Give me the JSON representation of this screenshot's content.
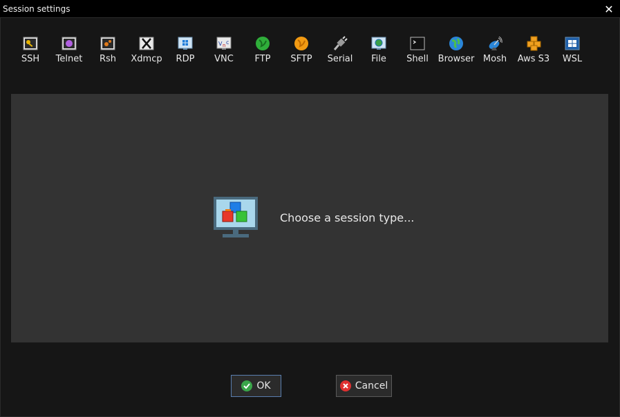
{
  "window": {
    "title": "Session settings",
    "close_glyph": "✕"
  },
  "session_types": [
    {
      "label": "SSH",
      "icon": "ssh-key-icon"
    },
    {
      "label": "Telnet",
      "icon": "telnet-icon"
    },
    {
      "label": "Rsh",
      "icon": "rsh-icon"
    },
    {
      "label": "Xdmcp",
      "icon": "xdmcp-icon"
    },
    {
      "label": "RDP",
      "icon": "rdp-icon"
    },
    {
      "label": "VNC",
      "icon": "vnc-icon"
    },
    {
      "label": "FTP",
      "icon": "ftp-globe-icon"
    },
    {
      "label": "SFTP",
      "icon": "sftp-globe-icon"
    },
    {
      "label": "Serial",
      "icon": "serial-plug-icon"
    },
    {
      "label": "File",
      "icon": "file-icon"
    },
    {
      "label": "Shell",
      "icon": "shell-terminal-icon"
    },
    {
      "label": "Browser",
      "icon": "browser-globe-icon"
    },
    {
      "label": "Mosh",
      "icon": "mosh-satellite-icon"
    },
    {
      "label": "Aws S3",
      "icon": "aws-s3-icon"
    },
    {
      "label": "WSL",
      "icon": "wsl-windows-icon"
    }
  ],
  "panel": {
    "prompt": "Choose a session type..."
  },
  "buttons": {
    "ok": "OK",
    "cancel": "Cancel"
  }
}
